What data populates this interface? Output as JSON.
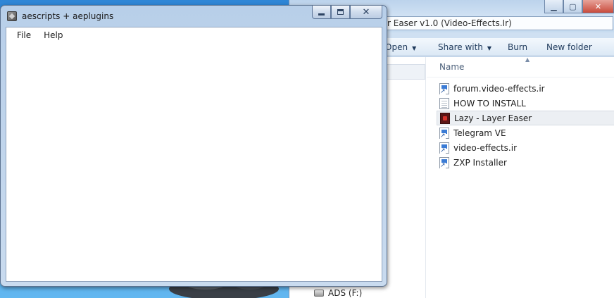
{
  "dialog": {
    "title": "aescripts + aeplugins",
    "icon": "app-icon",
    "controls": {
      "minimize_icon": "minimize-icon",
      "maximize_icon": "maximize-icon",
      "close_glyph": "✕"
    },
    "menu": [
      {
        "label": "File"
      },
      {
        "label": "Help"
      }
    ]
  },
  "explorer": {
    "address_fragment": "r Easer v1.0 (Video-Effects.Ir)",
    "toolbar": {
      "open_label": "Open",
      "share_label": "Share with",
      "burn_label": "Burn",
      "new_folder_label": "New folder"
    },
    "columns": {
      "name_header": "Name"
    },
    "files": [
      {
        "name": "forum.video-effects.ir",
        "icon": "shortcut-icon"
      },
      {
        "name": "HOW TO INSTALL",
        "icon": "document-icon"
      },
      {
        "name": "Lazy - Layer Easer",
        "icon": "app-icon",
        "selected": true
      },
      {
        "name": "Telegram VE",
        "icon": "shortcut-icon"
      },
      {
        "name": "video-effects.ir",
        "icon": "shortcut-icon"
      },
      {
        "name": "ZXP Installer",
        "icon": "shortcut-icon"
      }
    ],
    "nav": {
      "drive_label": "ADS (F:)"
    }
  },
  "colors": {
    "desktop": "#3d9be6",
    "window_frame": "#c9dbef",
    "selection": "#eceff3",
    "close_button": "#c94b3c"
  }
}
